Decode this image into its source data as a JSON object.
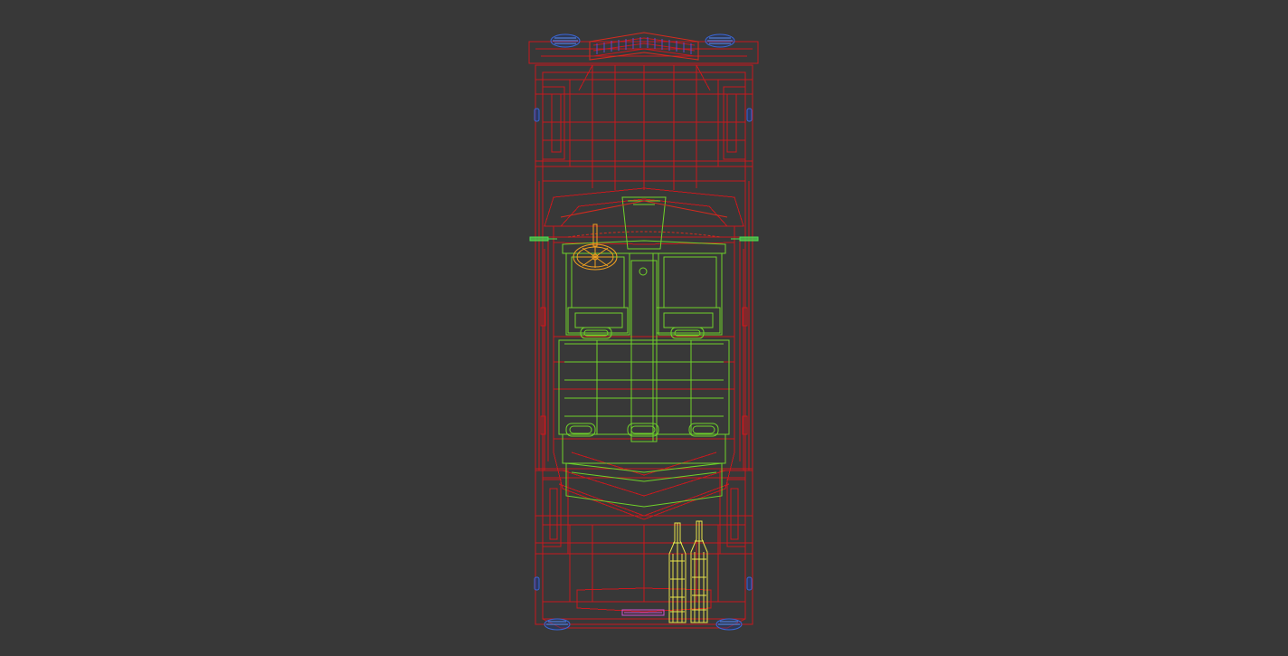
{
  "viewport": {
    "background_color": "#383838",
    "shading_mode": "wireframe",
    "view": "top"
  },
  "colors": {
    "body": "#c8191e",
    "body_alt": "#d62a1e",
    "interior": "#6fd22a",
    "steering": "#f0a020",
    "bottles": "#e8e44a",
    "lights": "#3a66d8",
    "mirrors": "#4fe04f",
    "plate": "#d050d0"
  },
  "scene_objects": [
    "car-body-wireframe",
    "interior-wireframe",
    "steering-wheel-wireframe",
    "bottles-wireframe",
    "headlights-wireframe",
    "taillights-wireframe",
    "side-mirrors-wireframe"
  ]
}
